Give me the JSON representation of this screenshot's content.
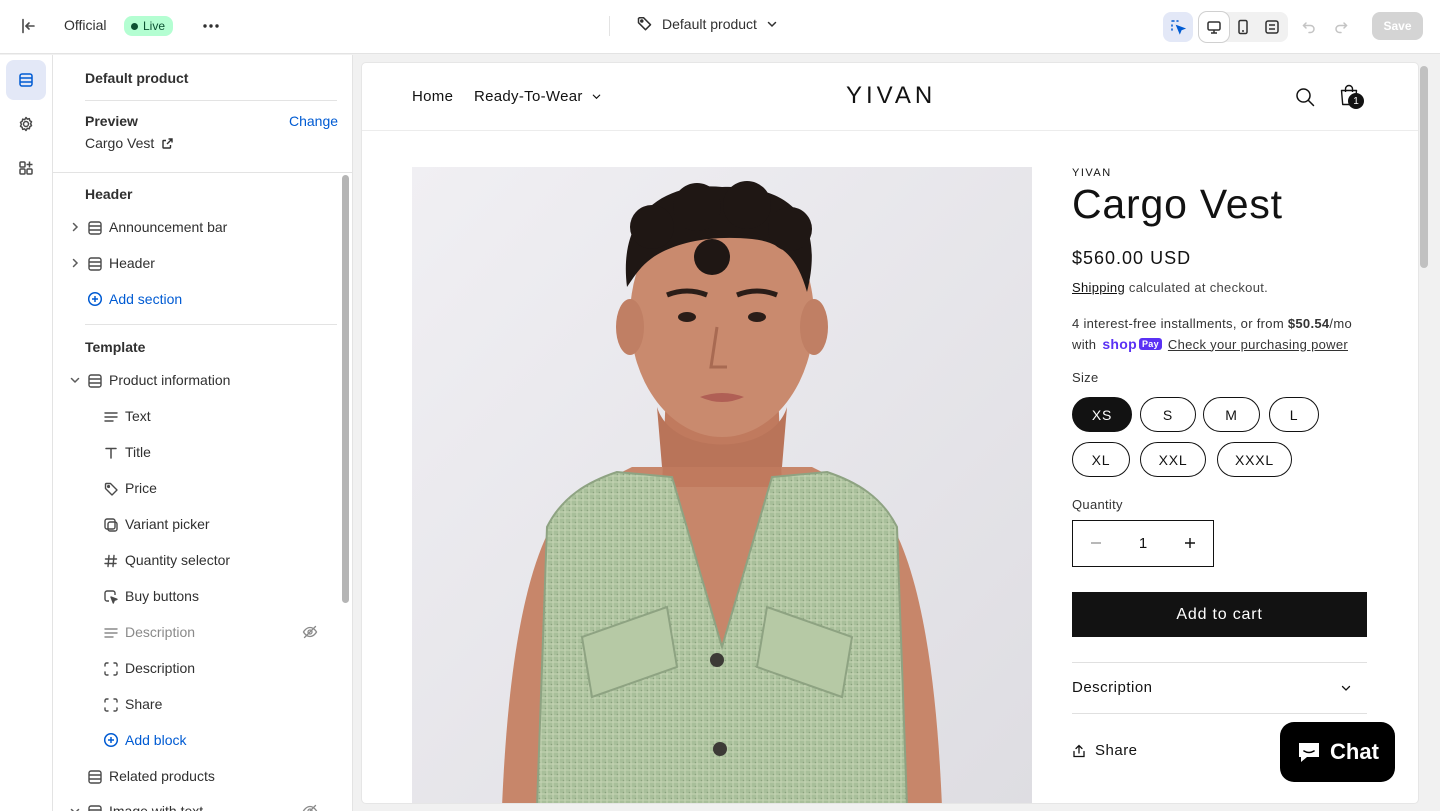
{
  "topbar": {
    "store_name": "Official",
    "status_badge": "Live",
    "template_name": "Default product",
    "save_label": "Save"
  },
  "sidebar": {
    "title": "Default product",
    "preview_label": "Preview",
    "change_label": "Change",
    "preview_product": "Cargo Vest",
    "header_group": {
      "label": "Header",
      "items": [
        {
          "label": "Announcement bar",
          "icon": "section-icon"
        },
        {
          "label": "Header",
          "icon": "section-icon"
        }
      ],
      "add_label": "Add section"
    },
    "template_group": {
      "label": "Template",
      "section": {
        "label": "Product information",
        "icon": "section-icon"
      },
      "blocks": [
        {
          "label": "Text",
          "icon": "text-icon"
        },
        {
          "label": "Title",
          "icon": "title-icon"
        },
        {
          "label": "Price",
          "icon": "price-tag-icon"
        },
        {
          "label": "Variant picker",
          "icon": "variant-icon"
        },
        {
          "label": "Quantity selector",
          "icon": "hash-icon"
        },
        {
          "label": "Buy buttons",
          "icon": "cursor-icon"
        },
        {
          "label": "Description",
          "icon": "text-icon",
          "hidden": true
        },
        {
          "label": "Description",
          "icon": "dashed-box-icon"
        },
        {
          "label": "Share",
          "icon": "dashed-box-icon"
        }
      ],
      "add_block_label": "Add block",
      "next_sections": [
        {
          "label": "Related products",
          "icon": "section-icon"
        },
        {
          "label": "Image with text",
          "icon": "section-icon"
        }
      ]
    }
  },
  "storefront": {
    "nav": {
      "home": "Home",
      "ready_to_wear": "Ready-To-Wear"
    },
    "logo": "YIVAN",
    "cart_count": "1",
    "product": {
      "vendor": "YIVAN",
      "title": "Cargo Vest",
      "price": "$560.00 USD",
      "shipping_link": "Shipping",
      "shipping_text": " calculated at checkout.",
      "installments_prefix": "4 interest-free installments, or from ",
      "installments_amount": "$50.54",
      "installments_suffix": "/mo",
      "installments_with": "with",
      "shoppay_brand": "shop",
      "shoppay_pay": "Pay",
      "purchasing_power_link": "Check your purchasing power",
      "size_label": "Size",
      "sizes": [
        "XS",
        "S",
        "M",
        "L",
        "XL",
        "XXL",
        "XXXL"
      ],
      "selected_size": "XS",
      "quantity_label": "Quantity",
      "quantity_value": "1",
      "add_to_cart": "Add to cart",
      "description_label": "Description",
      "share_label": "Share"
    },
    "chat_label": "Chat"
  }
}
